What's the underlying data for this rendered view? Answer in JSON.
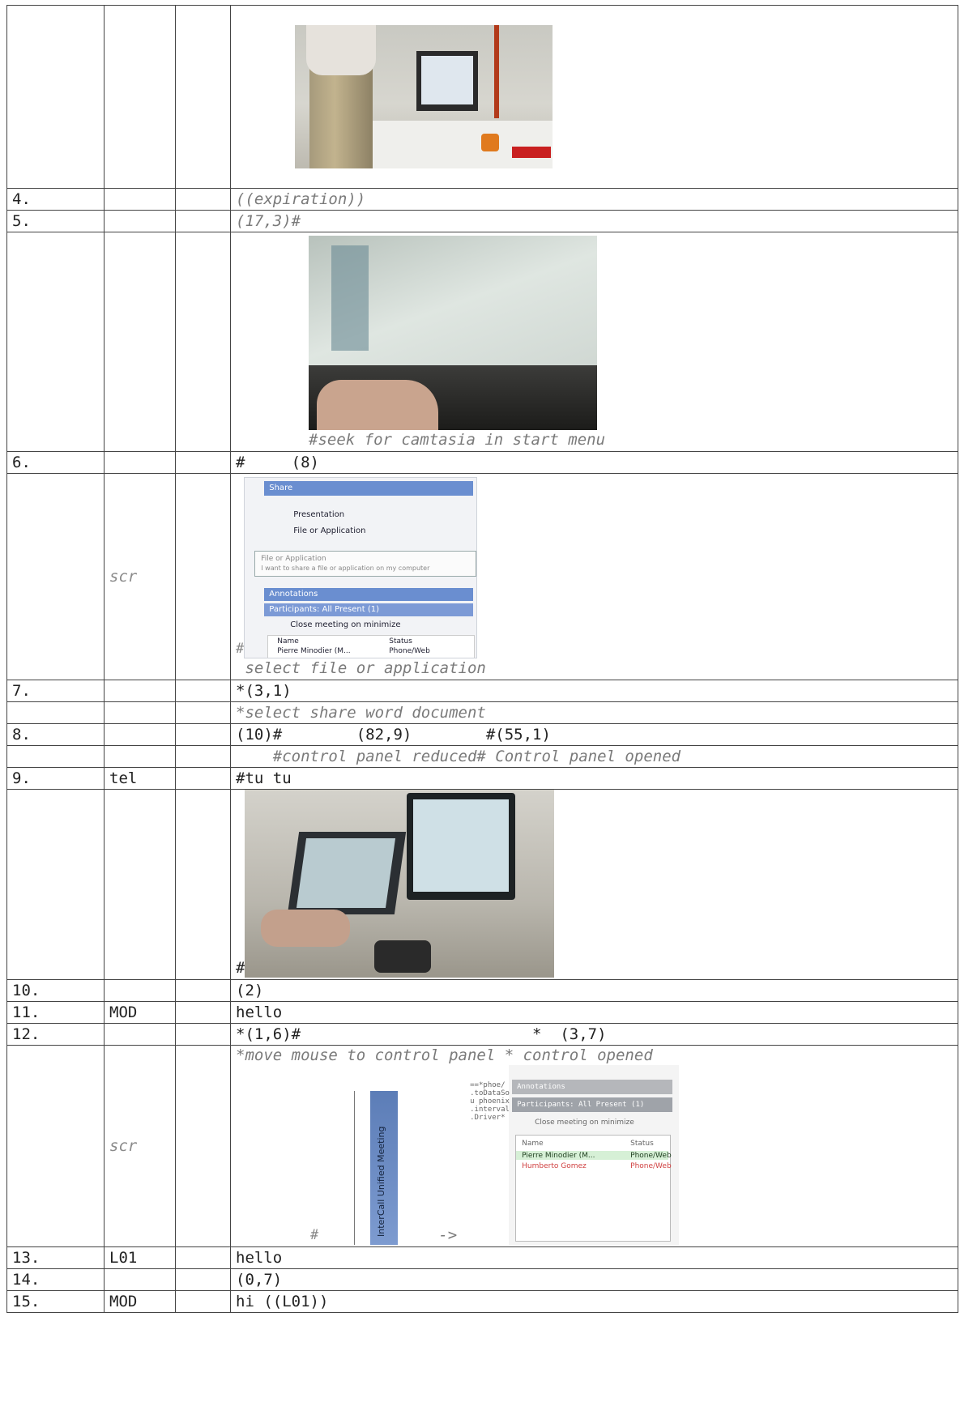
{
  "rows": {
    "r4": {
      "num": "4.",
      "text": "((expiration))"
    },
    "r5": {
      "num": "5.",
      "text": "(17,3)#"
    },
    "r5img": {
      "caption": "#seek for camtasia in start menu"
    },
    "r6": {
      "num": "6.",
      "text": "#     (8)"
    },
    "r6img": {
      "speaker": "scr",
      "caption": " select file or application",
      "hash": "#"
    },
    "r7": {
      "num": "7.",
      "text": "*(3,1)"
    },
    "r7note": {
      "text": "*select share word document"
    },
    "r8": {
      "num": "8.",
      "text": "(10)#        (82,9)        #(55,1)"
    },
    "r8note": {
      "text": "    #control panel reduced# Control panel opened"
    },
    "r9": {
      "num": "9.",
      "speaker": "tel",
      "text": "#tu tu"
    },
    "r9img": {
      "hash": "#"
    },
    "r10": {
      "num": "10.",
      "text": "(2)"
    },
    "r11": {
      "num": "11.",
      "speaker": "MOD",
      "text": "hello"
    },
    "r12": {
      "num": "12.",
      "text": "*(1,6)#                         *  (3,7)"
    },
    "r12note": {
      "speaker": "scr",
      "text": "*move mouse to control panel * control opened",
      "hash": "#",
      "arrow": "->"
    },
    "r13": {
      "num": "13.",
      "speaker": "L01",
      "text": "hello"
    },
    "r14": {
      "num": "14.",
      "text": "(0,7)"
    },
    "r15": {
      "num": "15.",
      "speaker": "MOD",
      "text": "hi ((L01))"
    }
  },
  "frame1": {
    "hash": "#"
  },
  "shot_share": {
    "title": "Share",
    "opt1": "Presentation",
    "opt2": "File or Application",
    "tip1": "File or Application",
    "tip2": "I want to share a file or application on my computer",
    "sec1": "Annotations",
    "sec2": "Participants: All Present (1)",
    "chk": "Close meeting on minimize",
    "col1": "Name",
    "col2": "Status",
    "row1a": "Pierre Minodier (M...",
    "row1b": "Phone/Web"
  },
  "shot_control": {
    "vertical": "InterCall Unified Meeting",
    "code": "==*phoe/\n.toDataSo\nu phoenix\n.interval\n.Driver*",
    "sec1": "Annotations",
    "sec2": "Participants: All Present (1)",
    "chk": "Close meeting on minimize",
    "col1": "Name",
    "col2": "Status",
    "row1a": "Pierre Minodier (M...",
    "row1b": "Phone/Web",
    "row2a": "Humberto Gomez",
    "row2b": "Phone/Web"
  }
}
